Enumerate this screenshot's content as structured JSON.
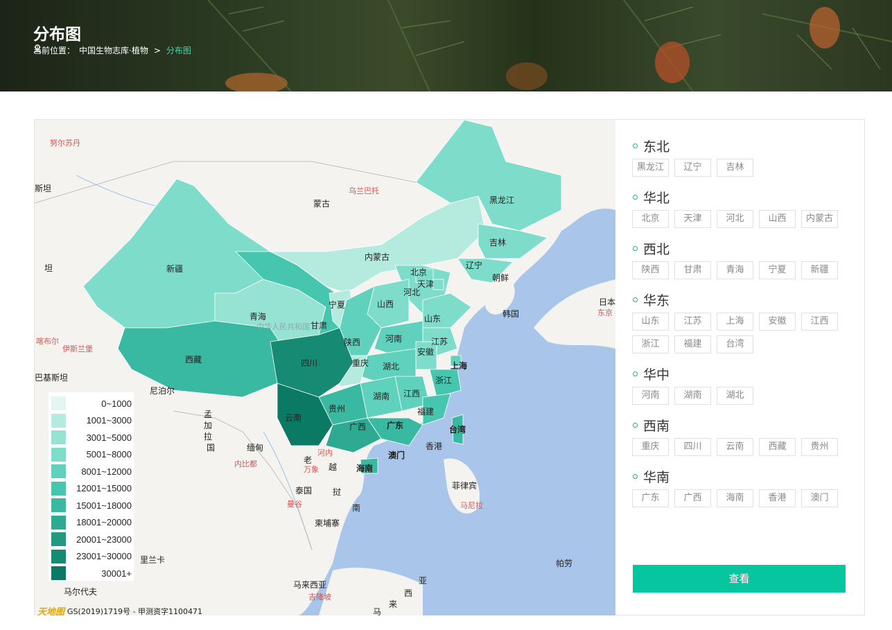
{
  "banner": {
    "title": "分布图",
    "breadcrumb_prefix": "当前位置：",
    "breadcrumb_parent": "中国生物志库·植物",
    "breadcrumb_sep": ">",
    "breadcrumb_current": "分布图"
  },
  "map": {
    "labels": {
      "nuer": "努尔苏丹",
      "sitan": "斯坦",
      "wulan": "乌兰巴托",
      "menggu": "蒙古",
      "heilongjiang": "黑龙江",
      "jilin": "吉林",
      "neimenggu": "内蒙古",
      "xinjiang": "新疆",
      "liaoning": "辽宁",
      "beijing": "北京",
      "tianjin": "天津",
      "hebei": "河北",
      "chaoxian": "朝鲜",
      "riben": "日本",
      "dongjing": "东京",
      "tan": "坦",
      "qinghai": "青海",
      "gansu": "甘肃",
      "ningxia": "宁夏",
      "shanxi": "山西",
      "shandong": "山东",
      "hanguo": "韩国",
      "kashi": "喀布尔",
      "yilanbao": "伊斯兰堡",
      "zhonghua": "中华人民共和国",
      "shaanxi": "陕西",
      "henan": "河南",
      "jiangsu": "江苏",
      "anhui": "安徽",
      "xizang": "西藏",
      "sichuan": "四川",
      "chongqing": "重庆",
      "hubei": "湖北",
      "shanghai": "上海",
      "bajisitan": "巴基斯坦",
      "zhejiang": "浙江",
      "niboer": "尼泊尔",
      "hunan": "湖南",
      "jiangxi": "江西",
      "guizhou": "贵州",
      "yunnan": "云南",
      "fujian": "福建",
      "guangxi": "广西",
      "guangdong": "广东",
      "taiwan": "台湾",
      "mengjia": "孟",
      "jia": "加",
      "la": "拉",
      "guo": "国",
      "miandian": "缅甸",
      "xianggang": "香港",
      "aomen": "澳门",
      "hanei": "河内",
      "lao": "老",
      "yue": "越",
      "kolkata": "内比都",
      "wanxiang": "万象",
      "hainan": "海南",
      "feilvbin": "菲律宾",
      "taiguo": "泰国",
      "ting": "挝",
      "mangu": "曼谷",
      "manila": "马尼拉",
      "nan": "南",
      "jianpuzhai": "柬埔寨",
      "silanka": "里兰卡",
      "palao": "帕劳",
      "malaixiya": "马来西亚",
      "ya": "亚",
      "maerdaifu": "马尔代夫",
      "jilongpo": "吉隆坡",
      "xi": "西",
      "ma": "马",
      "lai": "来"
    }
  },
  "legend": [
    {
      "label": "0~1000",
      "color": "#e3f6f1"
    },
    {
      "label": "1001~3000",
      "color": "#b5ebdf"
    },
    {
      "label": "3001~5000",
      "color": "#97e3d3"
    },
    {
      "label": "5001~8000",
      "color": "#7edccb"
    },
    {
      "label": "8001~12000",
      "color": "#5fd1bc"
    },
    {
      "label": "12001~15000",
      "color": "#46c6ae"
    },
    {
      "label": "15001~18000",
      "color": "#39b9a1"
    },
    {
      "label": "18001~20000",
      "color": "#2eaa92"
    },
    {
      "label": "20001~23000",
      "color": "#229a82"
    },
    {
      "label": "23001~30000",
      "color": "#168a73"
    },
    {
      "label": "30001+",
      "color": "#0b7a64"
    }
  ],
  "copyright": {
    "logo": "天地图",
    "text": "GS(2019)1719号 - 甲测资字1100471"
  },
  "regions": [
    {
      "name": "东北",
      "provinces": [
        "黑龙江",
        "辽宁",
        "吉林"
      ]
    },
    {
      "name": "华北",
      "provinces": [
        "北京",
        "天津",
        "河北",
        "山西",
        "内蒙古"
      ]
    },
    {
      "name": "西北",
      "provinces": [
        "陕西",
        "甘肃",
        "青海",
        "宁夏",
        "新疆"
      ]
    },
    {
      "name": "华东",
      "provinces": [
        "山东",
        "江苏",
        "上海",
        "安徽",
        "江西",
        "浙江",
        "福建",
        "台湾"
      ]
    },
    {
      "name": "华中",
      "provinces": [
        "河南",
        "湖南",
        "湖北"
      ]
    },
    {
      "name": "西南",
      "provinces": [
        "重庆",
        "四川",
        "云南",
        "西藏",
        "贵州"
      ]
    },
    {
      "name": "华南",
      "provinces": [
        "广东",
        "广西",
        "海南",
        "香港",
        "澳门"
      ]
    }
  ],
  "view_button": "查看"
}
